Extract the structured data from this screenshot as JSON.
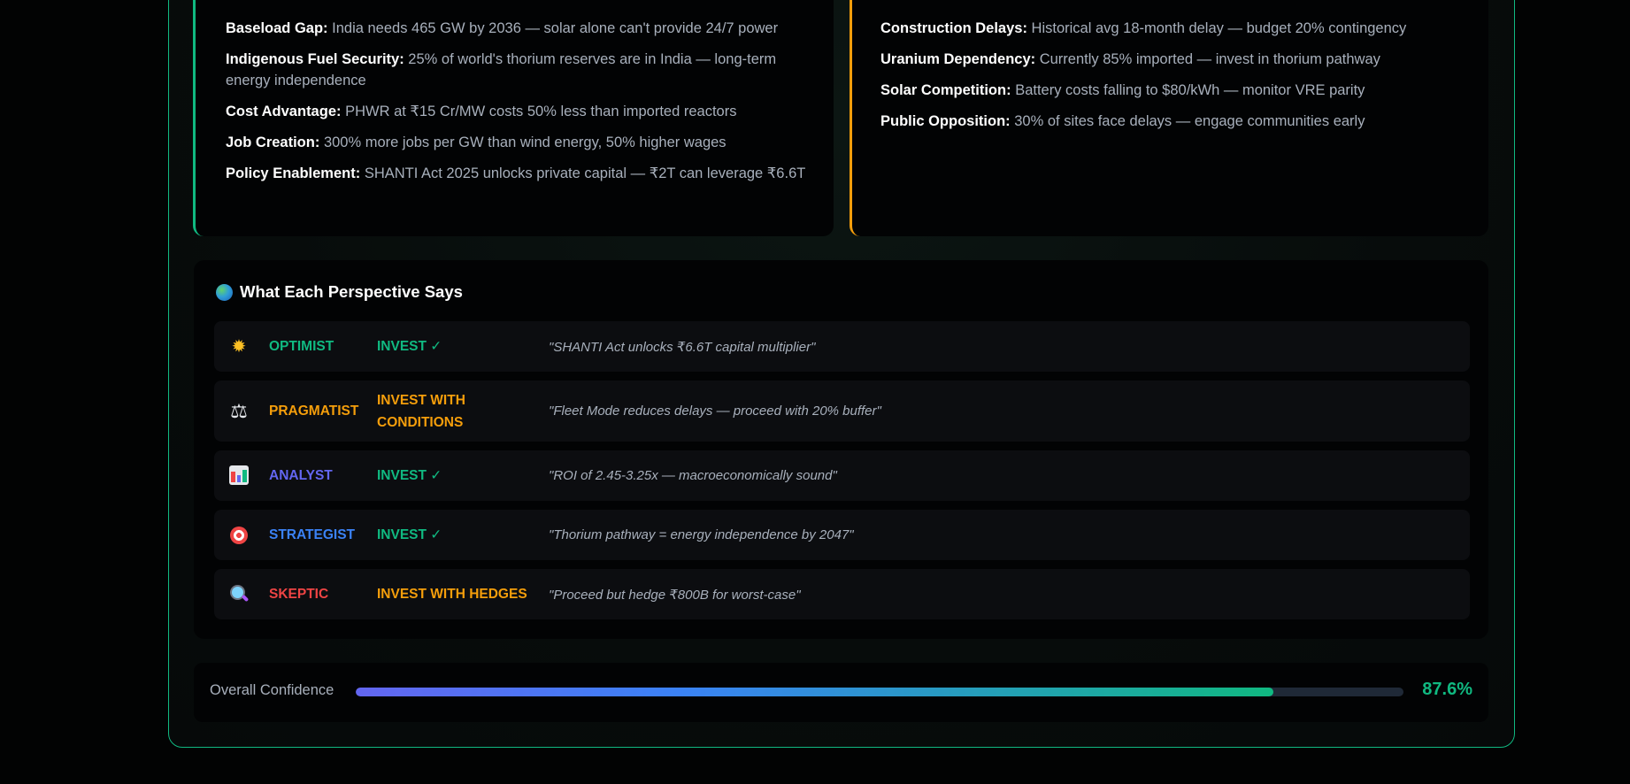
{
  "pros": {
    "accent": "#10b981",
    "items": [
      {
        "title": "Baseload Gap:",
        "text": "India needs 465 GW by 2036 — solar alone can't provide 24/7 power"
      },
      {
        "title": "Indigenous Fuel Security:",
        "text": "25% of world's thorium reserves are in India — long-term energy independence"
      },
      {
        "title": "Cost Advantage:",
        "text": "PHWR at ₹15 Cr/MW costs 50% less than imported reactors"
      },
      {
        "title": "Job Creation:",
        "text": "300% more jobs per GW than wind energy, 50% higher wages"
      },
      {
        "title": "Policy Enablement:",
        "text": "SHANTI Act 2025 unlocks private capital — ₹2T can leverage ₹6.6T"
      }
    ]
  },
  "risks": {
    "accent": "#f59e0b",
    "items": [
      {
        "title": "Construction Delays:",
        "text": "Historical avg 18-month delay — budget 20% contingency"
      },
      {
        "title": "Uranium Dependency:",
        "text": "Currently 85% imported — invest in thorium pathway"
      },
      {
        "title": "Solar Competition:",
        "text": "Battery costs falling to $80/kWh — monitor VRE parity"
      },
      {
        "title": "Public Opposition:",
        "text": "30% of sites face delays — engage communities early"
      }
    ]
  },
  "perspectives": {
    "title": "What Each Perspective Says",
    "title_icon": "globe-icon",
    "rows": [
      {
        "icon": "sun-icon",
        "role": "OPTIMIST",
        "role_color": "#10b981",
        "verdict": "INVEST ✓",
        "verdict_color": "#10b981",
        "quote": "\"SHANTI Act unlocks ₹6.6T capital multiplier\""
      },
      {
        "icon": "balance-scale-icon",
        "role": "PRAGMATIST",
        "role_color": "#f59e0b",
        "verdict": "INVEST WITH CONDITIONS",
        "verdict_color": "#f59e0b",
        "quote": "\"Fleet Mode reduces delays — proceed with 20% buffer\""
      },
      {
        "icon": "bar-chart-icon",
        "role": "ANALYST",
        "role_color": "#6366f1",
        "verdict": "INVEST ✓",
        "verdict_color": "#10b981",
        "quote": "\"ROI of 2.45-3.25x — macroeconomically sound\""
      },
      {
        "icon": "target-icon",
        "role": "STRATEGIST",
        "role_color": "#3b82f6",
        "verdict": "INVEST ✓",
        "verdict_color": "#10b981",
        "quote": "\"Thorium pathway = energy independence by 2047\""
      },
      {
        "icon": "magnifying-glass-icon",
        "role": "SKEPTIC",
        "role_color": "#ef4444",
        "verdict": "INVEST WITH HEDGES",
        "verdict_color": "#f59e0b",
        "quote": "\"Proceed but hedge ₹800B for worst-case\""
      }
    ]
  },
  "confidence": {
    "label": "Overall Confidence",
    "value_text": "87.6%",
    "value": 0.876,
    "color": "#10b981"
  }
}
